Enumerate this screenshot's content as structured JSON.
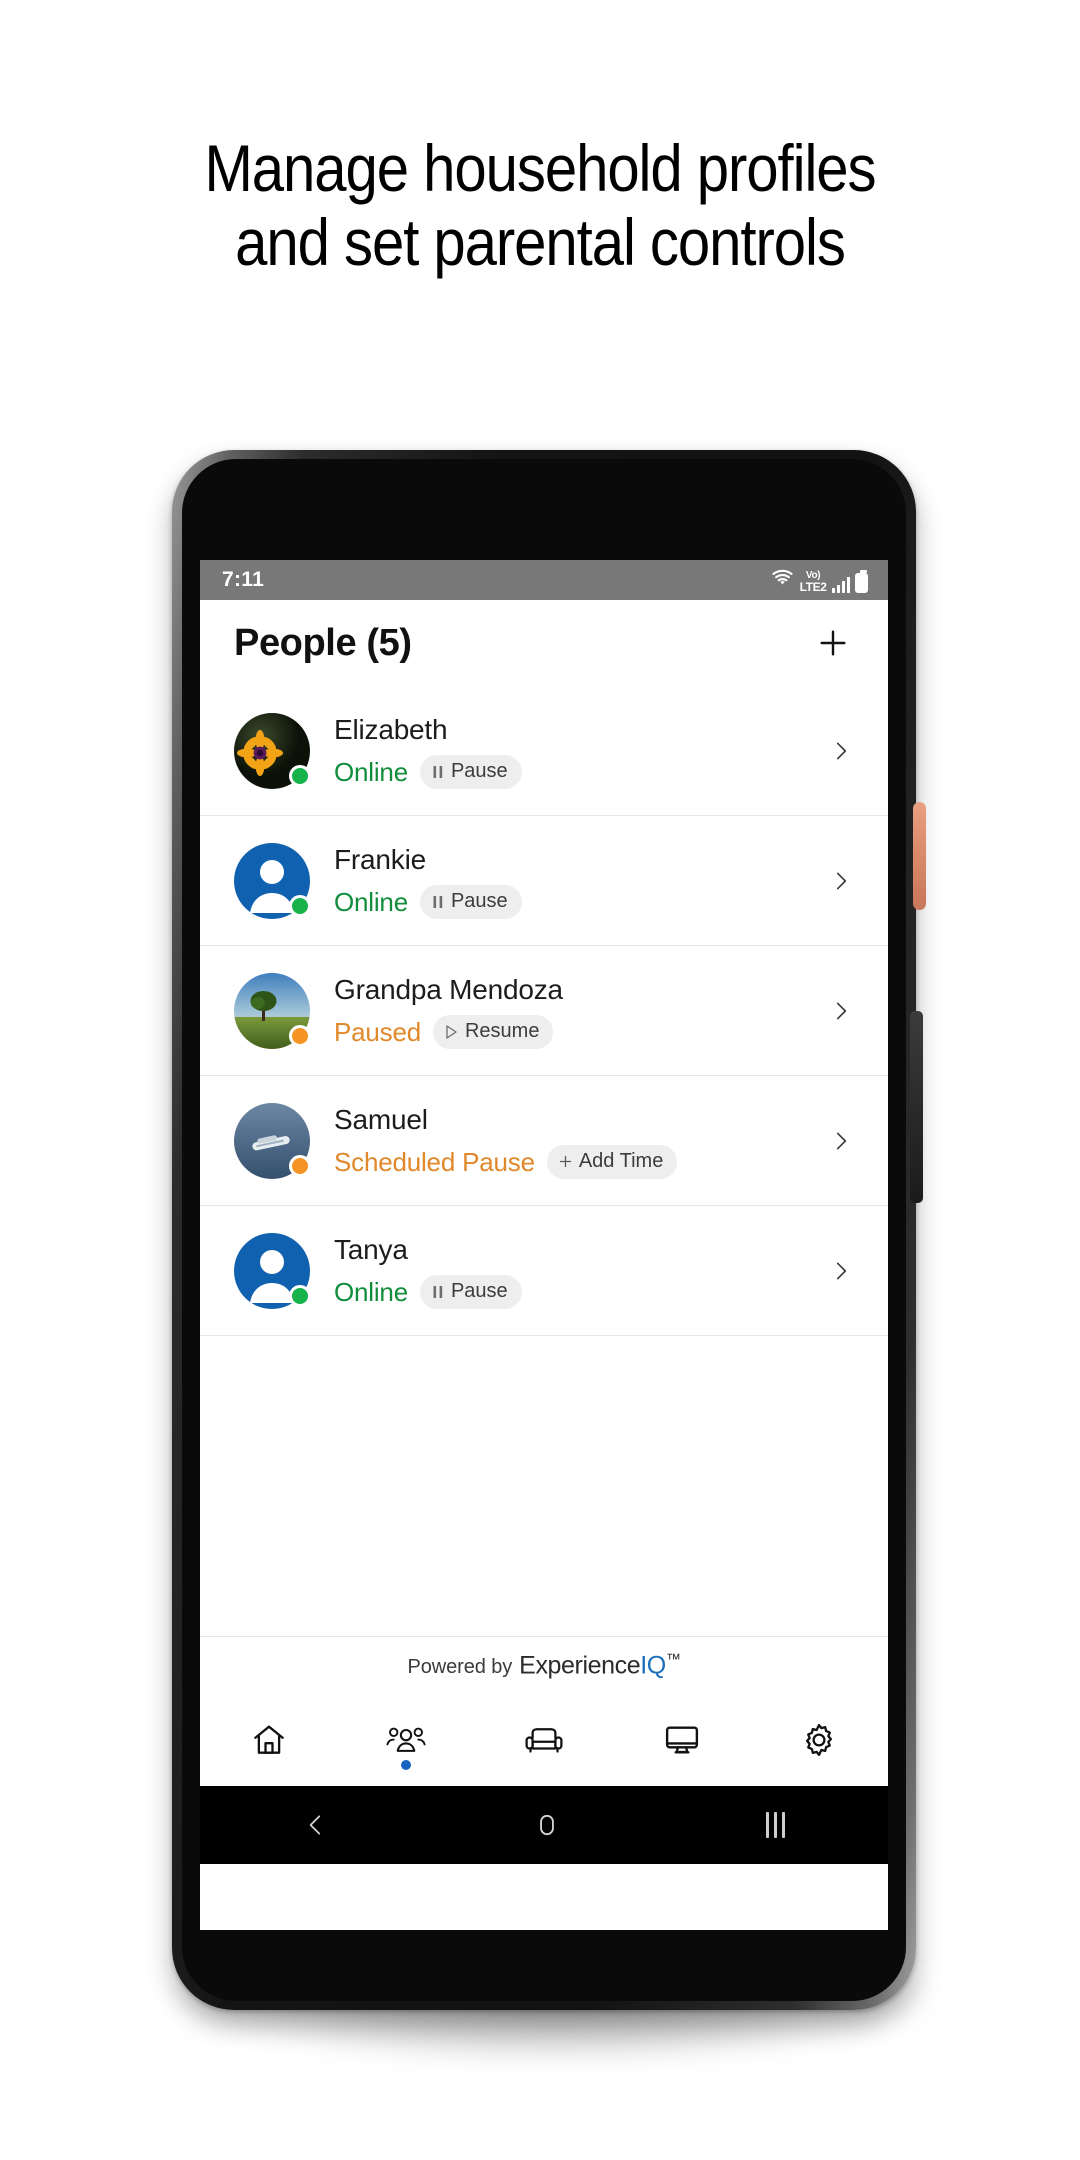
{
  "headline": {
    "line1": "Manage household profiles",
    "line2": "and set parental controls"
  },
  "phone": {
    "status_bar": {
      "time": "7:11",
      "volte_top": "Vo)",
      "volte_bottom": "LTE2",
      "wifi_icon": "wifi-icon",
      "signal_icon": "signal-bars-icon",
      "battery_icon": "battery-full-icon"
    },
    "android_nav": {
      "back": "back-icon",
      "home": "home-circle-icon",
      "recents": "recent-apps-icon"
    }
  },
  "app": {
    "header": {
      "title": "People (5)",
      "add_label": "+"
    },
    "people": [
      {
        "name": "Elizabeth",
        "status": "Online",
        "status_state": "online",
        "action": "Pause",
        "action_icon": "pause-icon",
        "avatar": "sunflower-photo",
        "chevron": "chevron-right-icon"
      },
      {
        "name": "Frankie",
        "status": "Online",
        "status_state": "online",
        "action": "Pause",
        "action_icon": "pause-icon",
        "avatar": "default-person-avatar",
        "chevron": "chevron-right-icon"
      },
      {
        "name": "Grandpa Mendoza",
        "status": "Paused",
        "status_state": "paused",
        "action": "Resume",
        "action_icon": "play-icon",
        "avatar": "landscape-tree-photo",
        "chevron": "chevron-right-icon"
      },
      {
        "name": "Samuel",
        "status": "Scheduled Pause",
        "status_state": "paused",
        "action": "Add Time",
        "action_icon": "plus-icon",
        "avatar": "boat-photo",
        "chevron": "chevron-right-icon"
      },
      {
        "name": "Tanya",
        "status": "Online",
        "status_state": "online",
        "action": "Pause",
        "action_icon": "pause-icon",
        "avatar": "default-person-avatar",
        "chevron": "chevron-right-icon"
      }
    ],
    "branding": {
      "prefix": "Powered by",
      "name_part1": "Experience",
      "name_part2": "IQ",
      "trademark": "™"
    },
    "bottom_nav": [
      {
        "icon": "home-icon",
        "label": "Home",
        "active": false
      },
      {
        "icon": "people-icon",
        "label": "People",
        "active": true
      },
      {
        "icon": "sofa-icon",
        "label": "Places",
        "active": false
      },
      {
        "icon": "monitor-icon",
        "label": "Devices",
        "active": false
      },
      {
        "icon": "gear-icon",
        "label": "Settings",
        "active": false
      }
    ]
  },
  "colors": {
    "online": "#118d3c",
    "paused": "#e1882a",
    "accent": "#1565c0",
    "brand_iq": "#1c6fba",
    "statusbar_bg": "#787878"
  }
}
